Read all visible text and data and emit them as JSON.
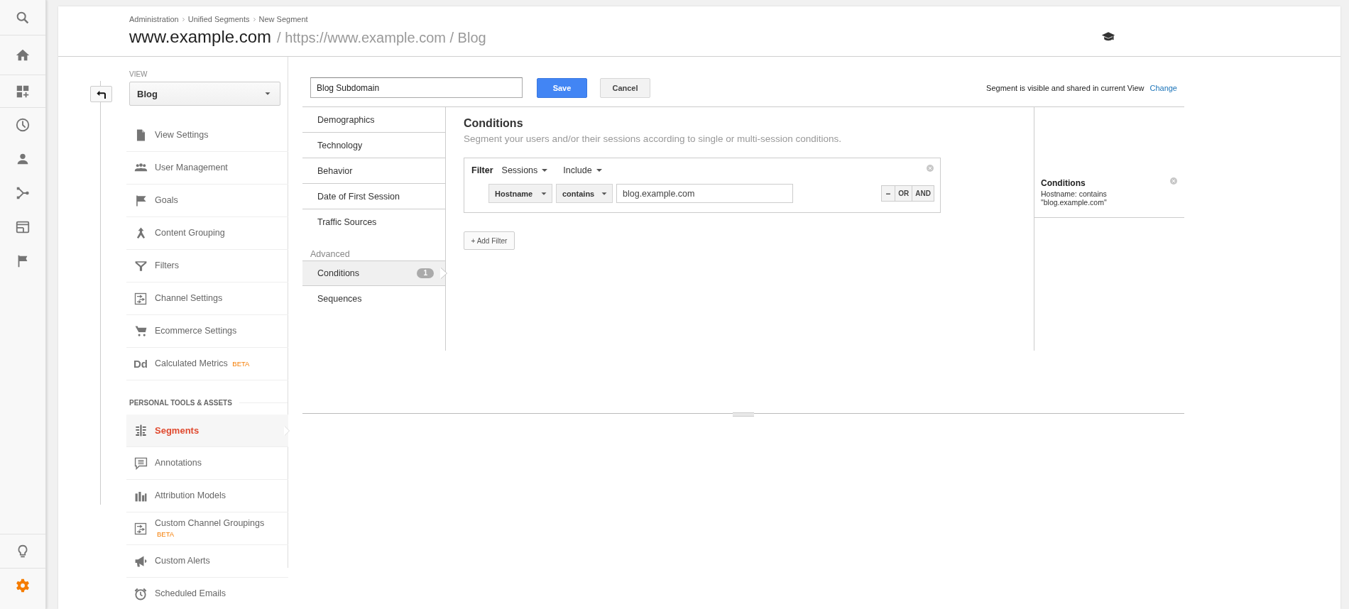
{
  "rail": {
    "top_items": [
      {
        "selected": false
      },
      {
        "selected": false
      },
      {
        "selected": false
      },
      {
        "selected": false
      },
      {
        "selected": false
      },
      {
        "selected": false
      },
      {
        "selected": false
      },
      {
        "selected": false
      }
    ],
    "bottom_items": [
      {
        "selected": false
      },
      {
        "selected": true
      }
    ]
  },
  "header": {
    "breadcrumb": [
      "Administration",
      "Unified Segments",
      "New Segment"
    ],
    "account": "www.example.com",
    "path": "/ https://www.example.com / Blog"
  },
  "admin_nav": {
    "view_label": "VIEW",
    "view_select": "Blog",
    "view_items": [
      {
        "label": "View Settings",
        "selected": false
      },
      {
        "label": "User Management",
        "selected": false
      },
      {
        "label": "Goals",
        "selected": false
      },
      {
        "label": "Content Grouping",
        "selected": false
      },
      {
        "label": "Filters",
        "selected": false
      },
      {
        "label": "Channel Settings",
        "selected": false
      },
      {
        "label": "Ecommerce Settings",
        "selected": false
      },
      {
        "label": "Calculated Metrics",
        "badge": "BETA",
        "glyph": "Dd",
        "selected": false
      }
    ],
    "section_title": "PERSONAL TOOLS & ASSETS",
    "personal_items": [
      {
        "label": "Segments",
        "selected": true
      },
      {
        "label": "Annotations",
        "selected": false
      },
      {
        "label": "Attribution Models",
        "selected": false
      },
      {
        "label": "Custom Channel Groupings",
        "badge": "BETA",
        "selected": false
      },
      {
        "label": "Custom Alerts",
        "selected": false
      },
      {
        "label": "Scheduled Emails",
        "selected": false
      }
    ]
  },
  "editor": {
    "name_field": "Blog Subdomain",
    "buttons": [
      {
        "label": "Save",
        "kind": "primary"
      },
      {
        "label": "Cancel",
        "kind": "secondary"
      }
    ],
    "visibility": "Segment is visible and shared in current View",
    "change_link": "Change",
    "categories": [
      {
        "label": "Demographics",
        "selected": false
      },
      {
        "label": "Technology",
        "selected": false
      },
      {
        "label": "Behavior",
        "selected": false
      },
      {
        "label": "Date of First Session",
        "selected": false
      },
      {
        "label": "Traffic Sources",
        "selected": false
      }
    ],
    "advanced_label": "Advanced",
    "advanced_categories": [
      {
        "label": "Conditions",
        "count": "1",
        "selected": true
      },
      {
        "label": "Sequences",
        "selected": false
      }
    ],
    "conditions": {
      "title": "Conditions",
      "subtitle": "Segment your users and/or their sessions according to single or multi-session conditions.",
      "filter": {
        "label": "Filter",
        "scope": "Sessions",
        "mode": "Include",
        "dimension": "Hostname",
        "operator": "contains",
        "value": "blog.example.com",
        "logic_buttons": [
          "OR",
          "AND"
        ]
      },
      "add_filter": "+ Add Filter"
    },
    "summary": {
      "title": "Conditions",
      "text": "Hostname: contains \"blog.example.com\""
    }
  }
}
